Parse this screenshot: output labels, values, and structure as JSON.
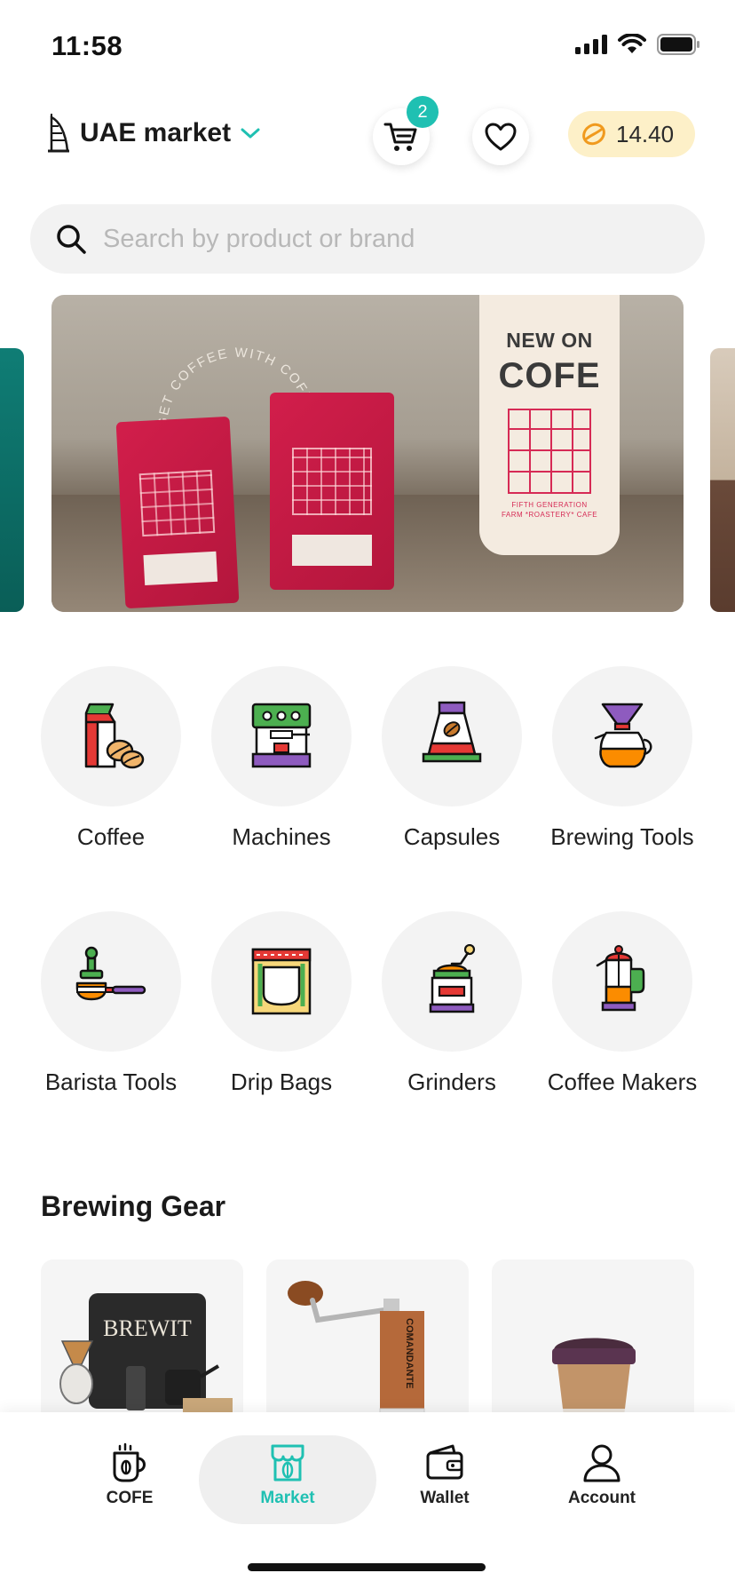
{
  "status_bar": {
    "time": "11:58"
  },
  "header": {
    "market_label": "UAE market",
    "cart_count": "2",
    "balance": "14.40"
  },
  "search": {
    "placeholder": "Search by product or brand"
  },
  "banner": {
    "line1": "NEW ON",
    "line2": "COFE",
    "circle_text": "GET COFFEE WITH COFE",
    "brand_text": "FIFTH GENERATION",
    "tagline": "FARM *ROASTERY* CAFE"
  },
  "categories": [
    {
      "label": "Coffee",
      "icon": "coffee-bag-icon"
    },
    {
      "label": "Machines",
      "icon": "espresso-machine-icon"
    },
    {
      "label": "Capsules",
      "icon": "capsule-icon"
    },
    {
      "label": "Brewing Tools",
      "icon": "pour-over-icon"
    },
    {
      "label": "Barista Tools",
      "icon": "portafilter-icon"
    },
    {
      "label": "Drip Bags",
      "icon": "drip-bag-icon"
    },
    {
      "label": "Grinders",
      "icon": "grinder-icon"
    },
    {
      "label": "Coffee Makers",
      "icon": "french-press-icon"
    }
  ],
  "section": {
    "title": "Brewing Gear"
  },
  "products": [
    {
      "name_on_image": "BREWIT"
    },
    {
      "name_on_image": "COMANDANTE"
    },
    {
      "name_on_image": ""
    }
  ],
  "tabs": [
    {
      "label": "COFE",
      "active": false
    },
    {
      "label": "Market",
      "active": true
    },
    {
      "label": "Wallet",
      "active": false
    },
    {
      "label": "Account",
      "active": false
    }
  ],
  "colors": {
    "accent": "#1fc0b2",
    "balance_bg": "#fdf0c8",
    "brand_red": "#d21e4b"
  }
}
